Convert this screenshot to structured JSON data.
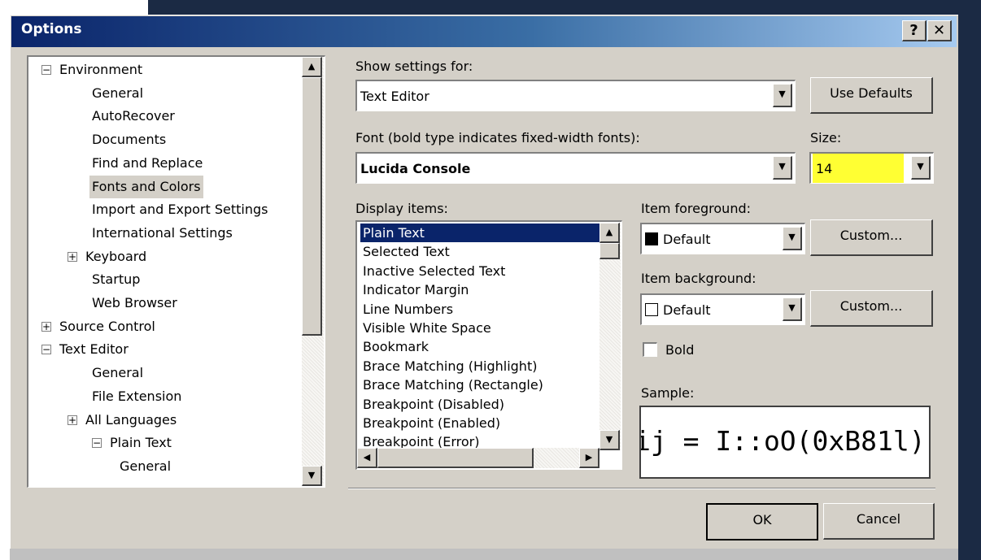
{
  "window": {
    "title": "Options",
    "help_button": "?",
    "close_button": "✕"
  },
  "tree": {
    "items": [
      {
        "label": "Environment",
        "expander": "−"
      },
      {
        "label": "General"
      },
      {
        "label": "AutoRecover"
      },
      {
        "label": "Documents"
      },
      {
        "label": "Find and Replace"
      },
      {
        "label": "Fonts and Colors",
        "selected": true
      },
      {
        "label": "Import and Export Settings"
      },
      {
        "label": "International Settings"
      },
      {
        "label": "Keyboard",
        "expander": "+"
      },
      {
        "label": "Startup"
      },
      {
        "label": "Web Browser"
      },
      {
        "label": "Source Control",
        "expander": "+"
      },
      {
        "label": "Text Editor",
        "expander": "−"
      },
      {
        "label": "General"
      },
      {
        "label": "File Extension"
      },
      {
        "label": "All Languages",
        "expander": "+"
      },
      {
        "label": "Plain Text",
        "expander": "−"
      },
      {
        "label": "General"
      }
    ]
  },
  "settings": {
    "show_settings_label": "Show settings for:",
    "show_settings_value": "Text Editor",
    "use_defaults_label": "Use Defaults",
    "font_label": "Font (bold type indicates fixed-width fonts):",
    "font_value": "Lucida Console",
    "size_label": "Size:",
    "size_value": "14",
    "size_highlight_color": "#ffff33"
  },
  "display_items": {
    "label": "Display items:",
    "items": [
      "Plain Text",
      "Selected Text",
      "Inactive Selected Text",
      "Indicator Margin",
      "Line Numbers",
      "Visible White Space",
      "Bookmark",
      "Brace Matching (Highlight)",
      "Brace Matching (Rectangle)",
      "Breakpoint (Disabled)",
      "Breakpoint (Enabled)",
      "Breakpoint (Error)"
    ],
    "selected_index": 0
  },
  "foreground": {
    "label": "Item foreground:",
    "value": "Default",
    "swatch_color": "#000000",
    "custom_label": "Custom..."
  },
  "background": {
    "label": "Item background:",
    "value": "Default",
    "swatch_color": "#ffffff",
    "custom_label": "Custom..."
  },
  "bold_label": "Bold",
  "bold_checked": false,
  "sample": {
    "label": "Sample:",
    "text": "ij = I::oO(0xB81l)"
  },
  "buttons": {
    "ok": "OK",
    "cancel": "Cancel"
  },
  "colors": {
    "title_gradient_start": "#0a246a",
    "dialog_face": "#d4d0c8",
    "selection": "#0a246a"
  }
}
